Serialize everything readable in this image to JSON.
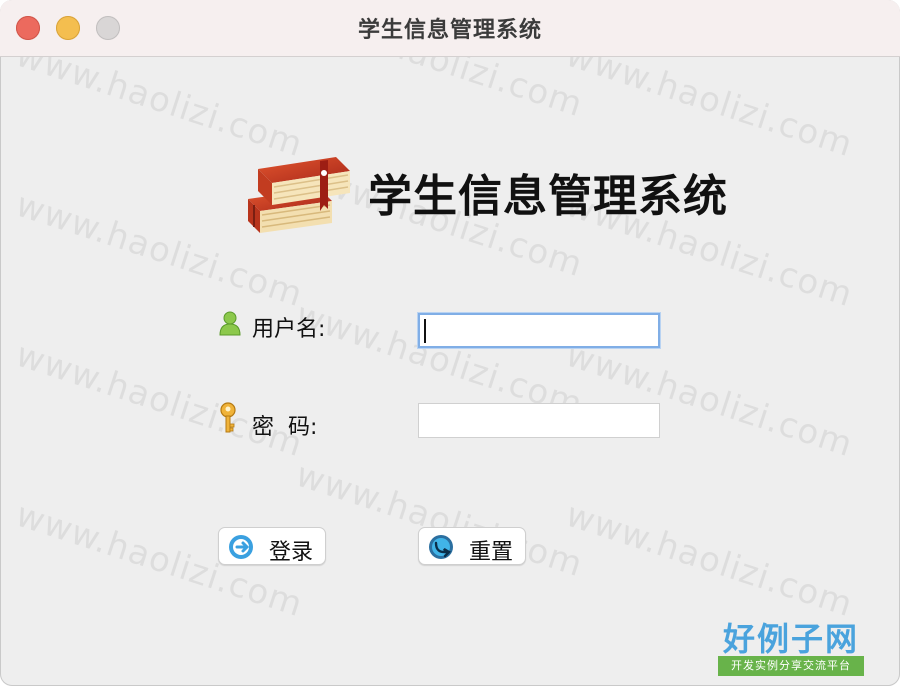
{
  "window": {
    "title": "学生信息管理系统"
  },
  "header": {
    "app_title": "学生信息管理系统",
    "logo_icon": "books-icon"
  },
  "form": {
    "username": {
      "label": "用户名:",
      "value": "",
      "icon": "user-icon",
      "focused": true
    },
    "password": {
      "label": "密  码:",
      "value": "",
      "icon": "key-icon"
    }
  },
  "buttons": {
    "login_label": "登录",
    "login_icon": "login-arrow-icon",
    "reset_label": "重置",
    "reset_icon": "reset-arrow-icon"
  },
  "watermark": {
    "text": "www.haolizi.com"
  },
  "brand": {
    "name": "好例子网",
    "tagline": "开发实例分享交流平台",
    "color_main": "#4aa3dd",
    "color_tag": "#68b34a"
  },
  "colors": {
    "close": "#ec6a5e",
    "minimize": "#f4be4f",
    "maximize": "#d9d6d6",
    "focus_ring": "#80aee6"
  }
}
